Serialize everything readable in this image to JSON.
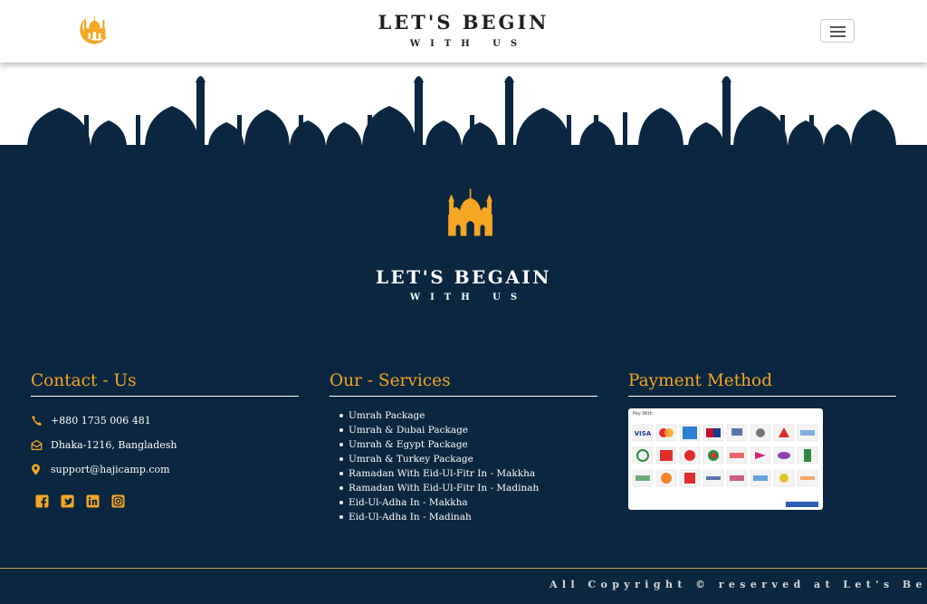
{
  "header": {
    "title": "LET'S BEGIN",
    "subtitle": "WITH US",
    "menu_icon": "hamburger-menu-icon"
  },
  "footer": {
    "brand_title": "LET'S BEGAIN",
    "brand_subtitle": "WITH US",
    "contact": {
      "heading": "Contact - Us",
      "phone": "+880 1735 006 481",
      "address": "Dhaka-1216, Bangladesh",
      "email": "support@hajicamp.com"
    },
    "services": {
      "heading": "Our - Services",
      "items": [
        "Umrah Package",
        "Umrah & Dubai Package",
        "Umrah & Egypt Package",
        "Umrah & Turkey Package",
        "Ramadan With Eid-Ul-Fitr In - Makkha",
        "Ramadan With Eid-Ul-Fitr In - Madinah",
        "Eid-Ul-Adha In - Makkha",
        "Eid-Ul-Adha In - Madinah"
      ]
    },
    "payment": {
      "heading": "Payment Method",
      "pay_with": "Pay With"
    },
    "copyright": "All Copyright © reserved at Let's Begain"
  },
  "colors": {
    "navy": "#0a2640",
    "accent": "#f5a623",
    "white": "#ffffff"
  },
  "icons": [
    "mosque-logo-icon",
    "phone-icon",
    "envelope-icon",
    "location-pin-icon",
    "facebook-icon",
    "twitter-icon",
    "linkedin-icon",
    "instagram-icon"
  ]
}
